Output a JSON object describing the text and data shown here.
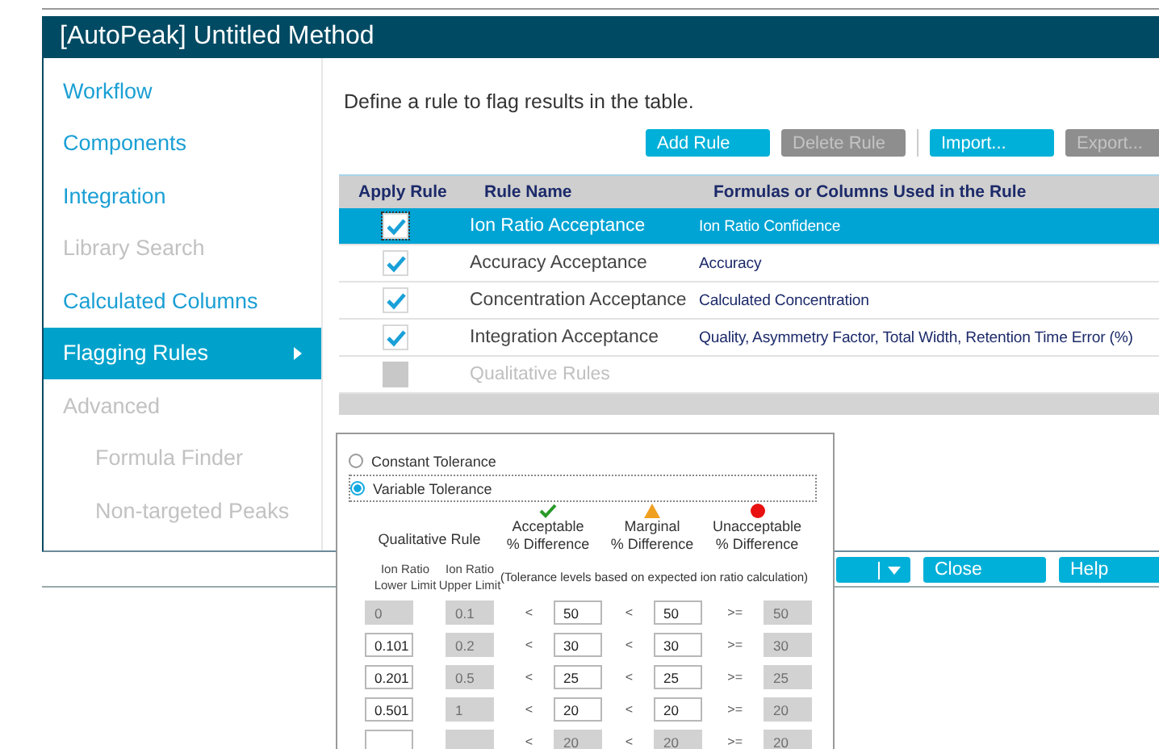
{
  "window": {
    "title": "[AutoPeak] Untitled Method"
  },
  "sidebar": {
    "items": [
      {
        "label": "Workflow",
        "disabled": false,
        "selected": false
      },
      {
        "label": "Components",
        "disabled": false,
        "selected": false
      },
      {
        "label": "Integration",
        "disabled": false,
        "selected": false
      },
      {
        "label": "Library Search",
        "disabled": true,
        "selected": false
      },
      {
        "label": "Calculated Columns",
        "disabled": false,
        "selected": false
      },
      {
        "label": "Flagging Rules",
        "disabled": false,
        "selected": true
      },
      {
        "label": "Advanced",
        "disabled": true,
        "selected": false,
        "children": [
          {
            "label": "Formula Finder",
            "disabled": true,
            "selected": false
          },
          {
            "label": "Non-targeted Peaks",
            "disabled": true,
            "selected": false
          }
        ]
      }
    ]
  },
  "instruction": "Define a rule to flag results in the table.",
  "toolbar": [
    {
      "label": "Add Rule",
      "disabled": false
    },
    {
      "label": "Delete Rule",
      "disabled": true
    },
    {
      "label": "Import...",
      "disabled": false
    },
    {
      "label": "Export...",
      "disabled": true
    }
  ],
  "table": {
    "columns": [
      "Apply Rule",
      "Rule Name",
      "Formulas or Columns Used in the Rule"
    ],
    "rows": [
      {
        "checked": true,
        "disabled": false,
        "selected": true,
        "name": "Ion Ratio Acceptance",
        "formula": "Ion Ratio Confidence"
      },
      {
        "checked": true,
        "disabled": false,
        "selected": false,
        "name": "Accuracy Acceptance",
        "formula": "Accuracy"
      },
      {
        "checked": true,
        "disabled": false,
        "selected": false,
        "name": "Concentration Acceptance",
        "formula": "Calculated Concentration"
      },
      {
        "checked": true,
        "disabled": false,
        "selected": false,
        "name": "Integration Acceptance",
        "formula": "Quality, Asymmetry Factor, Total Width, Retention Time Error (%)"
      },
      {
        "checked": false,
        "disabled": true,
        "selected": false,
        "name": "Qualitative Rules"
      }
    ]
  },
  "tolerance": {
    "options": [
      {
        "label": "Constant Tolerance",
        "selected": false
      },
      {
        "label": "Variable Tolerance",
        "selected": true
      }
    ],
    "qualitative_header": "Qualitative Rule",
    "levels": [
      {
        "kind": "check",
        "line1": "Acceptable",
        "line2": "% Difference"
      },
      {
        "kind": "triangle",
        "line1": "Marginal",
        "line2": "% Difference"
      },
      {
        "kind": "dot",
        "line1": "Unacceptable",
        "line2": "% Difference"
      }
    ],
    "lower_header": [
      "Ion Ratio",
      "Lower Limit"
    ],
    "upper_header": [
      "Ion Ratio",
      "Upper Limit"
    ],
    "note": "(Tolerance levels based on expected ion ratio calculation)",
    "rows": [
      {
        "cells": [
          {
            "value": "0",
            "disabled": true
          },
          {
            "value": "0.1",
            "disabled": true
          },
          {
            "op": "<"
          },
          {
            "value": "50",
            "disabled": false
          },
          {
            "op": "<"
          },
          {
            "value": "50",
            "disabled": false
          },
          {
            "op": ">="
          },
          {
            "value": "50",
            "disabled": true
          }
        ]
      },
      {
        "cells": [
          {
            "value": "0.101",
            "disabled": false
          },
          {
            "value": "0.2",
            "disabled": true
          },
          {
            "op": "<"
          },
          {
            "value": "30",
            "disabled": false
          },
          {
            "op": "<"
          },
          {
            "value": "30",
            "disabled": false
          },
          {
            "op": ">="
          },
          {
            "value": "30",
            "disabled": true
          }
        ]
      },
      {
        "cells": [
          {
            "value": "0.201",
            "disabled": false
          },
          {
            "value": "0.5",
            "disabled": true
          },
          {
            "op": "<"
          },
          {
            "value": "25",
            "disabled": false
          },
          {
            "op": "<"
          },
          {
            "value": "25",
            "disabled": false
          },
          {
            "op": ">="
          },
          {
            "value": "25",
            "disabled": true
          }
        ]
      },
      {
        "cells": [
          {
            "value": "0.501",
            "disabled": false
          },
          {
            "value": "1",
            "disabled": true
          },
          {
            "op": "<"
          },
          {
            "value": "20",
            "disabled": false
          },
          {
            "op": "<"
          },
          {
            "value": "20",
            "disabled": false
          },
          {
            "op": ">="
          },
          {
            "value": "20",
            "disabled": true
          }
        ]
      },
      {
        "cells": [
          {
            "disabled": false
          },
          {
            "disabled": true
          },
          {
            "op": "<"
          },
          {
            "value": "20",
            "disabled": true
          },
          {
            "op": "<"
          },
          {
            "value": "20",
            "disabled": true
          },
          {
            "op": ">="
          },
          {
            "value": "20",
            "disabled": true
          }
        ]
      }
    ]
  },
  "footer": [
    {
      "kind": "split"
    },
    {
      "kind": "button",
      "label": "Close"
    },
    {
      "kind": "button",
      "label": "Help"
    }
  ]
}
